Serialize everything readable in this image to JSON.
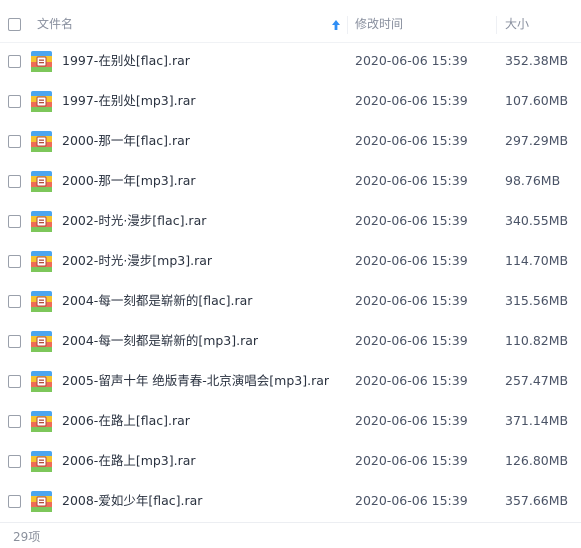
{
  "header": {
    "name_label": "文件名",
    "modified_label": "修改时间",
    "size_label": "大小",
    "sort_icon": "sort-ascending-arrow-icon"
  },
  "colors": {
    "sort_arrow": "#2f8ef5",
    "archive_icon_stripes": [
      "#4ba5f0",
      "#f4c430",
      "#ef6c57",
      "#7dc75a"
    ]
  },
  "files": [
    {
      "name": "1997-在别处[flac].rar",
      "modified": "2020-06-06 15:39",
      "size": "352.38MB",
      "icon": "rar-archive-icon"
    },
    {
      "name": "1997-在别处[mp3].rar",
      "modified": "2020-06-06 15:39",
      "size": "107.60MB",
      "icon": "rar-archive-icon"
    },
    {
      "name": "2000-那一年[flac].rar",
      "modified": "2020-06-06 15:39",
      "size": "297.29MB",
      "icon": "rar-archive-icon"
    },
    {
      "name": "2000-那一年[mp3].rar",
      "modified": "2020-06-06 15:39",
      "size": "98.76MB",
      "icon": "rar-archive-icon"
    },
    {
      "name": "2002-时光·漫步[flac].rar",
      "modified": "2020-06-06 15:39",
      "size": "340.55MB",
      "icon": "rar-archive-icon"
    },
    {
      "name": "2002-时光·漫步[mp3].rar",
      "modified": "2020-06-06 15:39",
      "size": "114.70MB",
      "icon": "rar-archive-icon"
    },
    {
      "name": "2004-每一刻都是崭新的[flac].rar",
      "modified": "2020-06-06 15:39",
      "size": "315.56MB",
      "icon": "rar-archive-icon"
    },
    {
      "name": "2004-每一刻都是崭新的[mp3].rar",
      "modified": "2020-06-06 15:39",
      "size": "110.82MB",
      "icon": "rar-archive-icon"
    },
    {
      "name": "2005-留声十年 绝版青春-北京演唱会[mp3].rar",
      "modified": "2020-06-06 15:39",
      "size": "257.47MB",
      "icon": "rar-archive-icon"
    },
    {
      "name": "2006-在路上[flac].rar",
      "modified": "2020-06-06 15:39",
      "size": "371.14MB",
      "icon": "rar-archive-icon"
    },
    {
      "name": "2006-在路上[mp3].rar",
      "modified": "2020-06-06 15:39",
      "size": "126.80MB",
      "icon": "rar-archive-icon"
    },
    {
      "name": "2008-爱如少年[flac].rar",
      "modified": "2020-06-06 15:39",
      "size": "357.66MB",
      "icon": "rar-archive-icon"
    }
  ],
  "footer": {
    "count_label": "29项"
  }
}
